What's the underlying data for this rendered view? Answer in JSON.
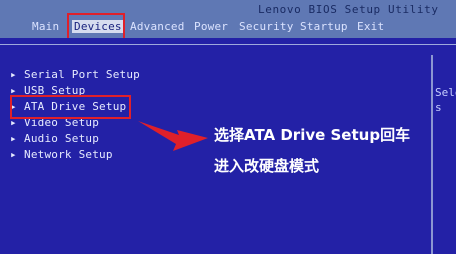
{
  "header": {
    "title": "Lenovo BIOS Setup Utility",
    "tabs": [
      {
        "label": "Main"
      },
      {
        "label": "Devices"
      },
      {
        "label": "Advanced"
      },
      {
        "label": "Power"
      },
      {
        "label": "Security"
      },
      {
        "label": "Startup"
      },
      {
        "label": "Exit"
      }
    ]
  },
  "devices_menu": {
    "items": [
      {
        "label": "Serial Port Setup"
      },
      {
        "label": "USB Setup"
      },
      {
        "label": "ATA Drive Setup"
      },
      {
        "label": "Video Setup"
      },
      {
        "label": "Audio Setup"
      },
      {
        "label": "Network Setup"
      }
    ]
  },
  "help_panel": {
    "lines": [
      "Sele",
      "s"
    ]
  },
  "annotation": {
    "line1": "选择ATA Drive Setup回车",
    "line2": "进入改硬盘模式"
  },
  "colors": {
    "background": "#1d1ba8",
    "header": "#5f78b4",
    "highlight_red": "#e0202a",
    "arrow_red": "#e0202a"
  }
}
